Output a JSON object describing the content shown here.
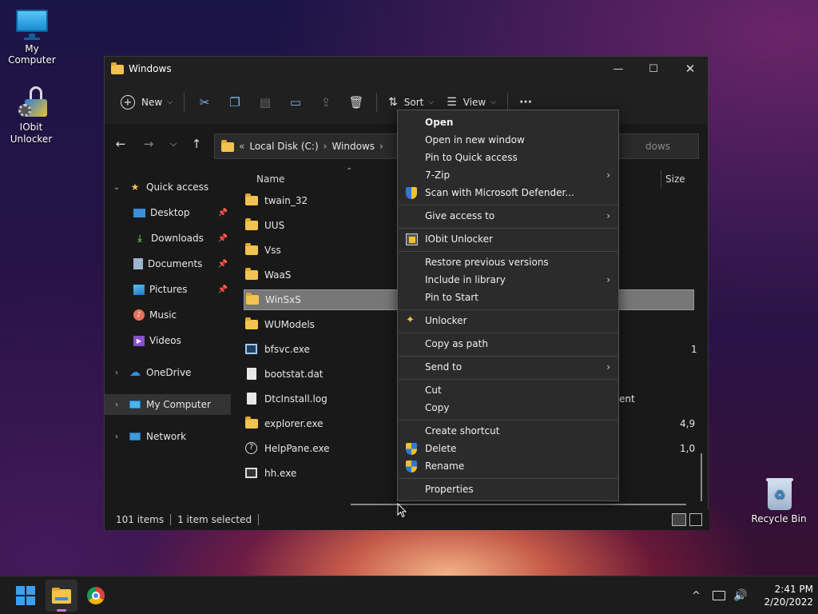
{
  "desktop": {
    "icons": [
      {
        "label": "My Computer"
      },
      {
        "label": "IObit Unlocker"
      },
      {
        "label": "Recycle Bin"
      }
    ]
  },
  "window": {
    "title": "Windows",
    "controls": {
      "minimize": "—",
      "maximize": "☐",
      "close": "✕"
    }
  },
  "toolbar": {
    "new_label": "New",
    "sort_label": "Sort",
    "view_label": "View",
    "more_label": "···"
  },
  "address": {
    "crumb_prefix": "«",
    "crumbs": [
      "Local Disk (C:)",
      "Windows"
    ],
    "search_placeholder": "dows"
  },
  "nav": {
    "items": [
      {
        "label": "Quick access"
      },
      {
        "label": "Desktop"
      },
      {
        "label": "Downloads"
      },
      {
        "label": "Documents"
      },
      {
        "label": "Pictures"
      },
      {
        "label": "Music"
      },
      {
        "label": "Videos"
      },
      {
        "label": "OneDrive"
      },
      {
        "label": "My Computer"
      },
      {
        "label": "Network"
      }
    ]
  },
  "files": {
    "columns": {
      "name": "Name",
      "size": "Size"
    },
    "rows": [
      {
        "name": "twain_32",
        "type": "folder",
        "size": ""
      },
      {
        "name": "UUS",
        "type": "folder",
        "size": ""
      },
      {
        "name": "Vss",
        "type": "folder",
        "size": ""
      },
      {
        "name": "WaaS",
        "type": "folder",
        "size": ""
      },
      {
        "name": "WinSxS",
        "type": "folder",
        "size": ""
      },
      {
        "name": "WUModels",
        "type": "folder",
        "size": ""
      },
      {
        "name": "bfsvc.exe",
        "type": "exe",
        "size": "1"
      },
      {
        "name": "bootstat.dat",
        "type": "doc",
        "size": ""
      },
      {
        "name": "DtcInstall.log",
        "type": "doc",
        "size": ""
      },
      {
        "name": "explorer.exe",
        "type": "exe",
        "size": "4,9"
      },
      {
        "name": "HelpPane.exe",
        "type": "exe",
        "size": "1,0"
      },
      {
        "name": "hh.exe",
        "type": "exe",
        "size": ""
      }
    ],
    "partial_type_text": "ent"
  },
  "status": {
    "items_count": "101 items",
    "selected": "1 item selected"
  },
  "context_menu": {
    "open": "Open",
    "open_new_window": "Open in new window",
    "pin_quick_access": "Pin to Quick access",
    "seven_zip": "7-Zip",
    "scan_defender": "Scan with Microsoft Defender...",
    "give_access": "Give access to",
    "iobit_unlocker": "IObit Unlocker",
    "restore_versions": "Restore previous versions",
    "include_library": "Include in library",
    "pin_start": "Pin to Start",
    "unlocker": "Unlocker",
    "copy_as_path": "Copy as path",
    "send_to": "Send to",
    "cut": "Cut",
    "copy": "Copy",
    "create_shortcut": "Create shortcut",
    "delete": "Delete",
    "rename": "Rename",
    "properties": "Properties",
    "submenu_arrow": "›"
  },
  "taskbar": {
    "time": "2:41 PM",
    "date": "2/20/2022",
    "tray_chevron": "^"
  },
  "colors": {
    "folder": "#f2c350",
    "accent": "#2b79d8",
    "selection": "#777777"
  }
}
